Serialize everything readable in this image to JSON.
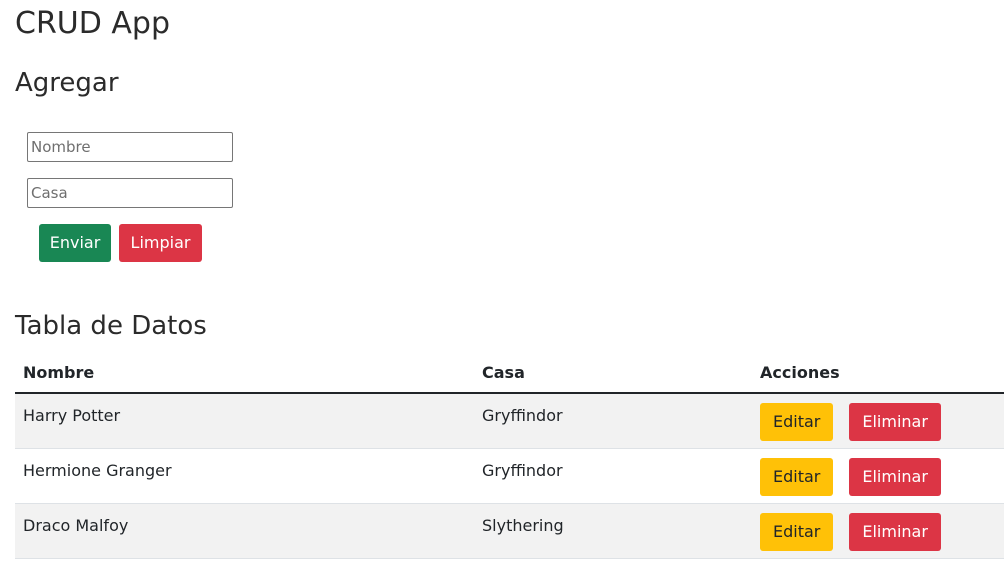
{
  "app": {
    "title": "CRUD App"
  },
  "form": {
    "title": "Agregar",
    "nombre_placeholder": "Nombre",
    "nombre_value": "",
    "casa_placeholder": "Casa",
    "casa_value": "",
    "submit_label": "Enviar",
    "clear_label": "Limpiar"
  },
  "table": {
    "title": "Tabla de Datos",
    "headers": [
      "Nombre",
      "Casa",
      "Acciones"
    ],
    "rows": [
      {
        "nombre": "Harry Potter",
        "casa": "Gryffindor",
        "edit_label": "Editar",
        "delete_label": "Eliminar"
      },
      {
        "nombre": "Hermione Granger",
        "casa": "Gryffindor",
        "edit_label": "Editar",
        "delete_label": "Eliminar"
      },
      {
        "nombre": "Draco Malfoy",
        "casa": "Slythering",
        "edit_label": "Editar",
        "delete_label": "Eliminar"
      }
    ]
  },
  "colors": {
    "success": "#198754",
    "danger": "#dc3545",
    "warning": "#ffc107",
    "stripe": "#f2f2f2"
  }
}
